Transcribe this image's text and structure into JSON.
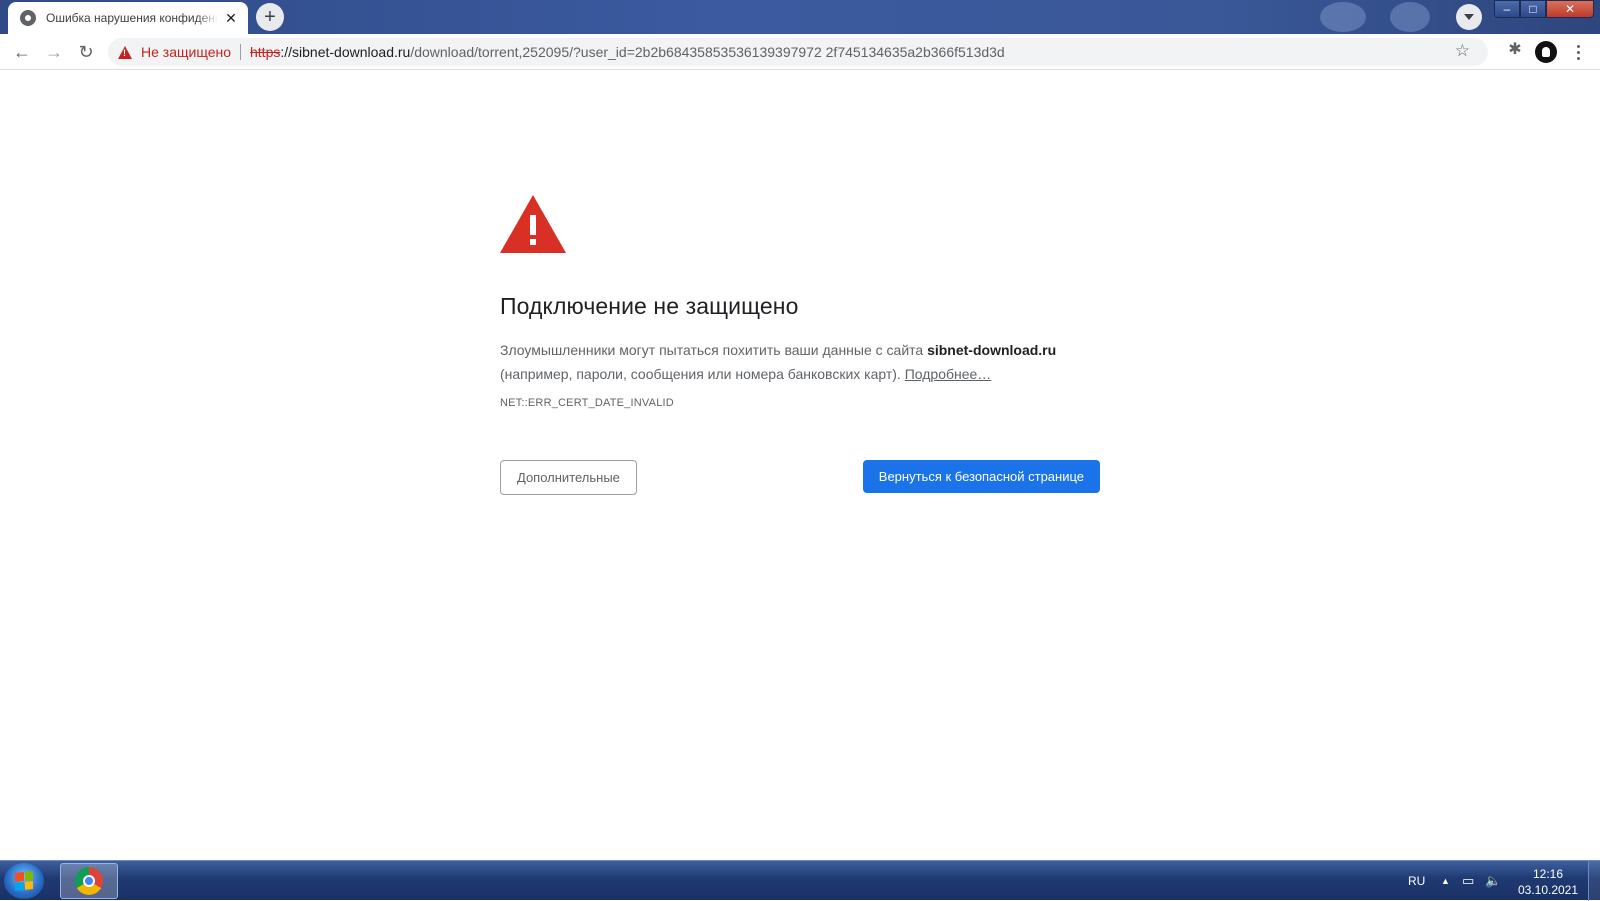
{
  "tab": {
    "title": "Ошибка нарушения конфиденциальности",
    "close_glyph": "✕",
    "new_tab_glyph": "+"
  },
  "toolbar": {
    "back_glyph": "←",
    "forward_glyph": "→",
    "reload_glyph": "↻",
    "security_label": "Не защищено",
    "url_scheme": "https",
    "url_host": "://sibnet-download.ru",
    "url_path": "/download/torrent,252095/?user_id=2b2b68435853536139397972 2f745134635a2b366f513d3d",
    "star_glyph": "☆",
    "extensions_glyph": "✱"
  },
  "window": {
    "minimize_glyph": "–",
    "maximize_glyph": "□",
    "close_glyph": "✕"
  },
  "interstitial": {
    "heading": "Подключение не защищено",
    "description_pre": "Злоумышленники могут пытаться похитить ваши данные с сайта ",
    "site": "sibnet-download.ru",
    "description_post": " (например, пароли, сообщения или номера банковских карт). ",
    "learn_more": "Подробнее…",
    "error_code": "NET::ERR_CERT_DATE_INVALID",
    "advanced_button": "Дополнительные",
    "back_button": "Вернуться к безопасной странице"
  },
  "taskbar": {
    "language": "RU",
    "tray_up_glyph": "▲",
    "network_glyph": "▭",
    "volume_glyph": "🔈",
    "time": "12:16",
    "date": "03.10.2021"
  },
  "colors": {
    "warning_red": "#d93025",
    "primary_blue": "#1a73e8",
    "insecure_red": "#c5221f"
  },
  "icons": [
    "globe-icon",
    "close-icon",
    "plus-icon",
    "back-arrow-icon",
    "forward-arrow-icon",
    "reload-icon",
    "warning-icon",
    "star-icon",
    "puzzle-icon",
    "avatar-icon",
    "kebab-menu-icon",
    "windows-start-icon",
    "chrome-icon"
  ]
}
